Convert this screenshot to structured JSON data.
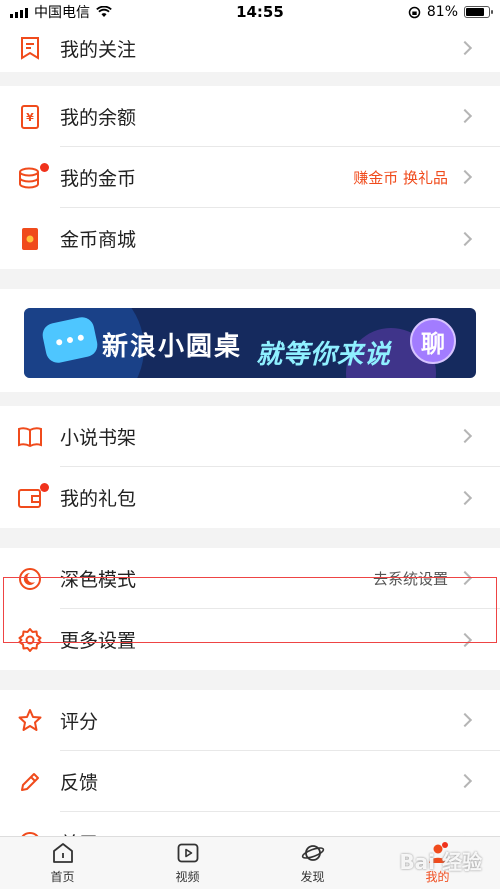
{
  "status_bar": {
    "carrier": "中国电信",
    "time": "14:55",
    "battery": "81%",
    "battery_level": 0.81
  },
  "menu": {
    "group0": [
      {
        "label": "我的关注"
      }
    ],
    "group1": [
      {
        "label": "我的余额"
      },
      {
        "label": "我的金币",
        "hint": "赚金币 换礼品"
      },
      {
        "label": "金币商城"
      }
    ],
    "banner": {
      "title": "新浪小圆桌",
      "slogan": "就等你来说",
      "badge": "聊"
    },
    "group2": [
      {
        "label": "小说书架"
      },
      {
        "label": "我的礼包"
      }
    ],
    "group3": [
      {
        "label": "深色模式",
        "hint": "去系统设置"
      },
      {
        "label": "更多设置"
      }
    ],
    "group4": [
      {
        "label": "评分"
      },
      {
        "label": "反馈"
      },
      {
        "label": "关于"
      }
    ]
  },
  "tabbar": [
    {
      "label": "首页"
    },
    {
      "label": "视频"
    },
    {
      "label": "发现"
    },
    {
      "label": "我的"
    }
  ],
  "colors": {
    "accent": "#f04b1c",
    "highlight": "#e44444"
  },
  "watermark": "Bai 经验"
}
